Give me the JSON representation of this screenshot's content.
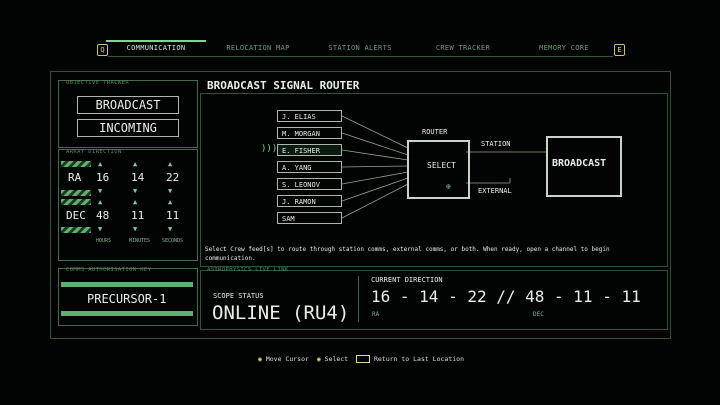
{
  "nav": {
    "left_key": "Q",
    "right_key": "E",
    "tabs": [
      "COMMUNICATION",
      "RELOCATION MAP",
      "STATION ALERTS",
      "CREW TRACKER",
      "MEMORY CORE"
    ]
  },
  "objective": {
    "label": "OBJECTIVE TRACKER",
    "items": [
      "BROADCAST",
      "INCOMING"
    ]
  },
  "array": {
    "label": "ARRAY DIRECTION",
    "ra": {
      "label": "RA",
      "values": [
        "16",
        "14",
        "22"
      ]
    },
    "dec": {
      "label": "DEC",
      "values": [
        "48",
        "11",
        "11"
      ]
    },
    "units": [
      "HOURS",
      "MINUTES",
      "SECONDS"
    ]
  },
  "auth": {
    "label": "COMMS AUTHORISATION KEY",
    "key": "PRECURSOR-1"
  },
  "router": {
    "title": "BROADCAST SIGNAL ROUTER",
    "feeds": [
      "J. ELIAS",
      "M. MORGAN",
      "E. FISHER",
      "A. YANG",
      "S. LEONOV",
      "J. RAMON",
      "SAM"
    ],
    "router_label": "ROUTER",
    "select_label": "SELECT",
    "station_label": "STATION",
    "external_label": "EXTERNAL",
    "broadcast_label": "BROADCAST",
    "instructions": "Select Crew feed[s] to route through station comms, external comms, or both. When ready, open a channel to begin communication."
  },
  "astro": {
    "label": "ASTROPHYSICS LIVE LINK",
    "scope_label": "SCOPE STATUS",
    "scope_value": "ONLINE (RU4)",
    "dir_label": "CURRENT DIRECTION",
    "dir_value": "16 - 14 - 22 // 48 - 11 - 11",
    "ra": "RA",
    "dec": "DEC"
  },
  "footer": {
    "move": "Move Cursor",
    "select": "Select",
    "back": "Return to Last Location"
  },
  "colors": {
    "accent": "#7fd48f",
    "frame": "#3f6d4a",
    "key": "#e2dc78"
  }
}
